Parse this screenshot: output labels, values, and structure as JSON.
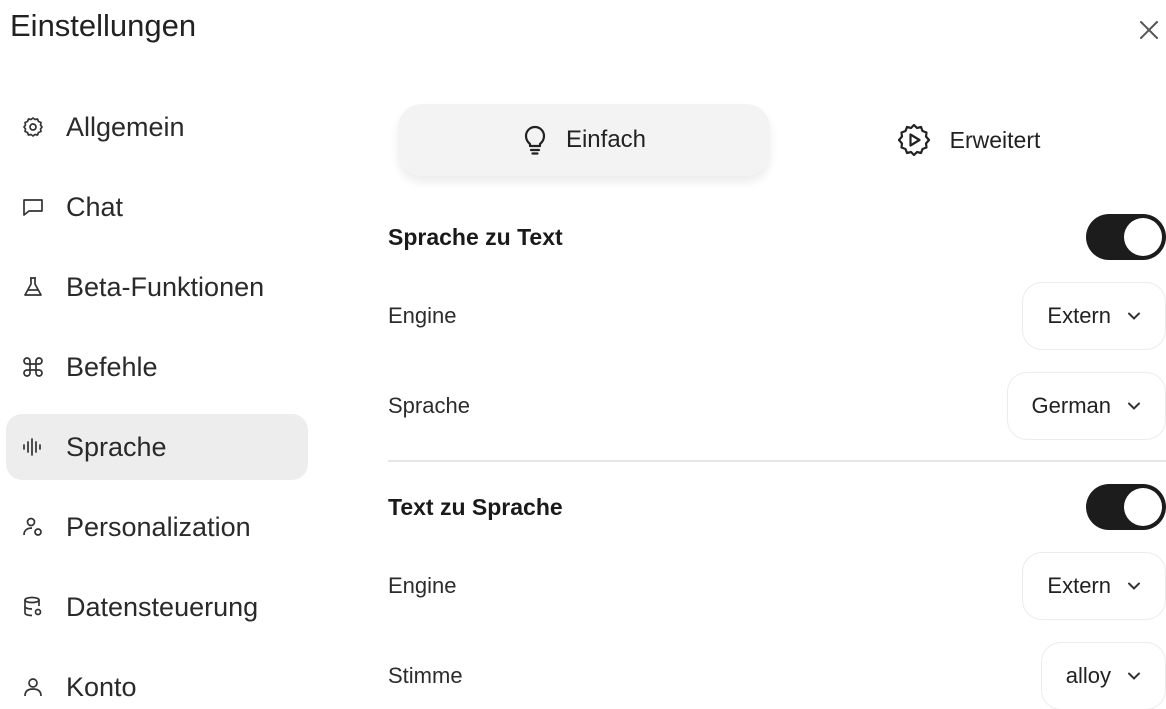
{
  "header": {
    "title": "Einstellungen",
    "close_icon": "close-icon"
  },
  "sidebar": {
    "items": [
      {
        "label": "Allgemein",
        "icon": "gear-icon"
      },
      {
        "label": "Chat",
        "icon": "chat-bubble-icon"
      },
      {
        "label": "Beta-Funktionen",
        "icon": "flask-icon"
      },
      {
        "label": "Befehle",
        "icon": "command-icon"
      },
      {
        "label": "Sprache",
        "icon": "waveform-icon",
        "active": true
      },
      {
        "label": "Personalization",
        "icon": "person-sparkle-icon"
      },
      {
        "label": "Datensteuerung",
        "icon": "database-gear-icon"
      },
      {
        "label": "Konto",
        "icon": "user-icon"
      }
    ]
  },
  "mode_tabs": {
    "simple": {
      "label": "Einfach",
      "icon": "lightbulb-icon",
      "active": true
    },
    "advanced": {
      "label": "Erweitert",
      "icon": "cog-play-icon"
    }
  },
  "speech_to_text": {
    "title": "Sprache zu Text",
    "enabled": true,
    "engine": {
      "label": "Engine",
      "value": "Extern"
    },
    "language": {
      "label": "Sprache",
      "value": "German"
    }
  },
  "text_to_speech": {
    "title": "Text zu Sprache",
    "enabled": true,
    "engine": {
      "label": "Engine",
      "value": "Extern"
    },
    "voice": {
      "label": "Stimme",
      "value": "alloy"
    }
  },
  "colors": {
    "toggle_on": "#1c1c1c",
    "active_bg": "#ededed"
  }
}
